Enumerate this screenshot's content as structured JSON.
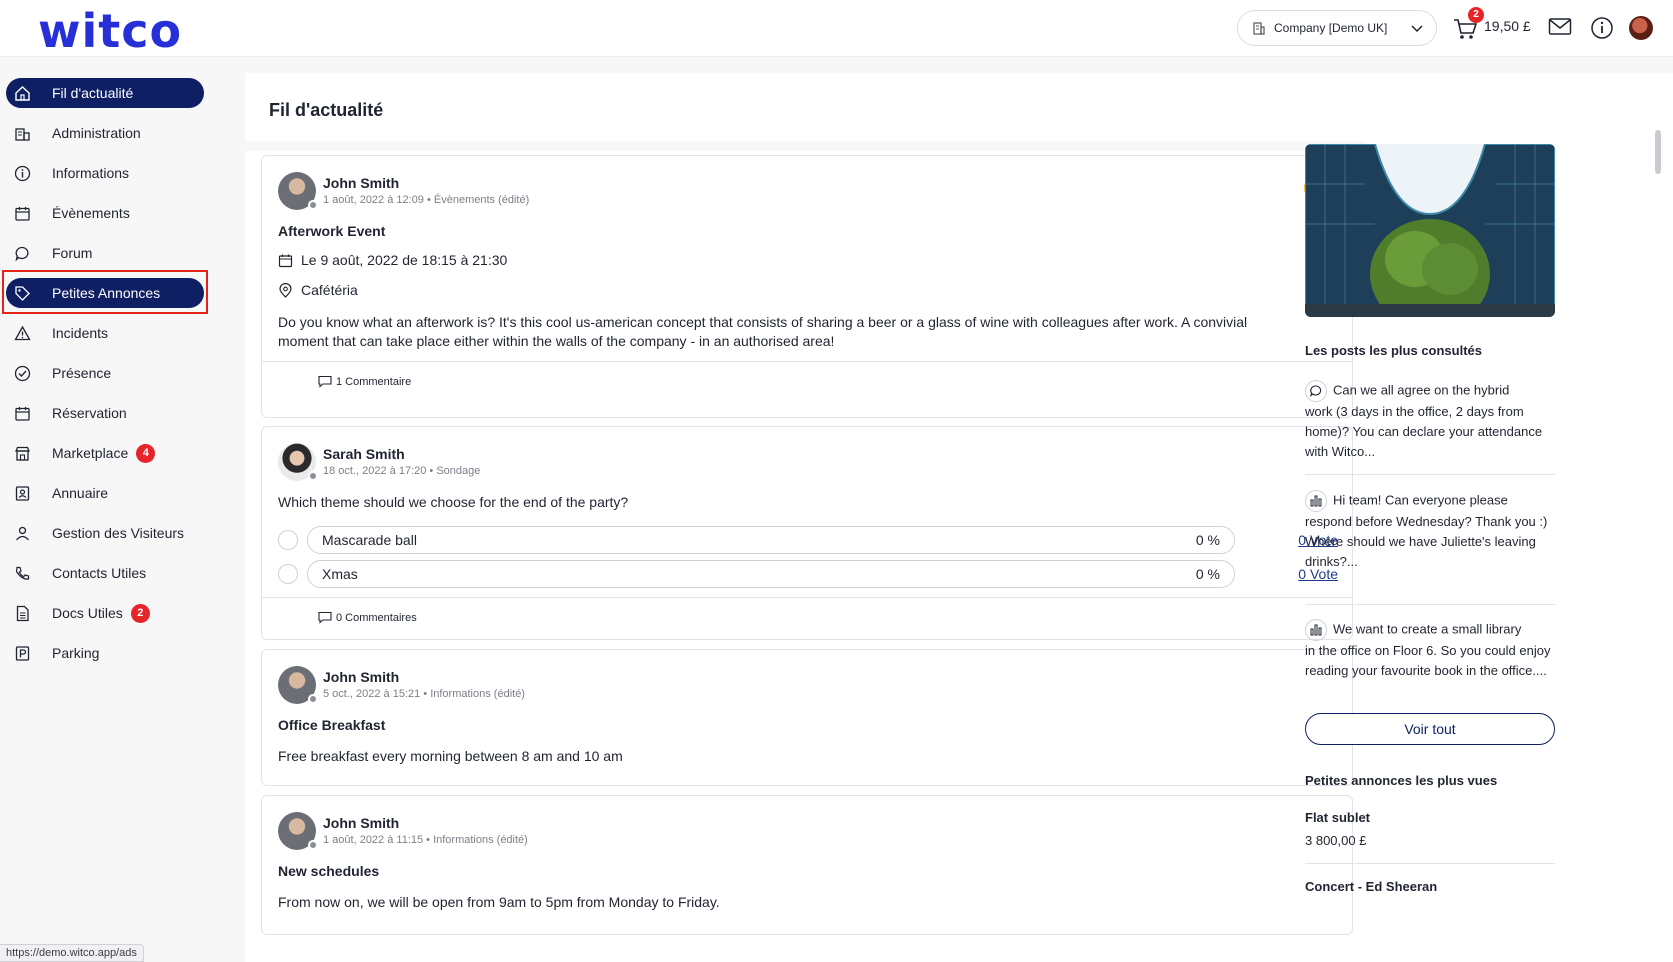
{
  "header": {
    "logo_text": "witco",
    "company_select": "Company [Demo UK]",
    "cart_badge": "2",
    "balance": "19,50 £"
  },
  "sidebar": {
    "items": [
      {
        "label": "Fil d'actualité",
        "icon": "home-icon"
      },
      {
        "label": "Administration",
        "icon": "building-icon"
      },
      {
        "label": "Informations",
        "icon": "info-icon"
      },
      {
        "label": "Évènements",
        "icon": "calendar-icon"
      },
      {
        "label": "Forum",
        "icon": "chat-icon"
      },
      {
        "label": "Petites Annonces",
        "icon": "tag-icon"
      },
      {
        "label": "Incidents",
        "icon": "warning-icon"
      },
      {
        "label": "Présence",
        "icon": "check-circle-icon"
      },
      {
        "label": "Réservation",
        "icon": "calendar-icon"
      },
      {
        "label": "Marketplace",
        "icon": "store-icon",
        "badge": "4"
      },
      {
        "label": "Annuaire",
        "icon": "contact-book-icon"
      },
      {
        "label": "Gestion des Visiteurs",
        "icon": "visitor-icon"
      },
      {
        "label": "Contacts Utiles",
        "icon": "phone-icon"
      },
      {
        "label": "Docs Utiles",
        "icon": "document-icon",
        "badge": "2"
      },
      {
        "label": "Parking",
        "icon": "parking-icon"
      }
    ]
  },
  "main": {
    "title": "Fil d'actualité",
    "posts": [
      {
        "author": "John Smith",
        "meta": "1 août, 2022 à 12:09 • Évènements (édité)",
        "title": "Afterwork Event",
        "date_line": "Le 9 août, 2022 de 18:15 à 21:30",
        "location": "Cafétéria",
        "body": "Do you know what an afterwork is? It's this cool us-american concept that consists of sharing a beer or a glass of wine with colleagues after work. A convivial moment that can take place either within the walls of the company - in an authorised area!",
        "comments": "1 Commentaire"
      },
      {
        "author": "Sarah Smith",
        "meta": "18 oct., 2022 à 17:20 • Sondage",
        "question": "Which theme should we choose for the end of the party?",
        "options": [
          {
            "label": "Mascarade ball",
            "percent": "0 %",
            "votes": "0 Vote"
          },
          {
            "label": "Xmas",
            "percent": "0 %",
            "votes": "0 Vote"
          }
        ],
        "comments": "0 Commentaires"
      },
      {
        "author": "John Smith",
        "meta": "5 oct., 2022 à 15:21 • Informations (édité)",
        "title": "Office Breakfast",
        "body": "Free breakfast every morning between 8 am and 10 am"
      },
      {
        "author": "John Smith",
        "meta": "1 août, 2022 à 11:15 • Informations (édité)",
        "title": "New schedules",
        "body": "From now on, we will be open from 9am to 5pm from Monday to Friday."
      }
    ]
  },
  "right": {
    "most_viewed_title": "Les posts les plus consultés",
    "most_viewed": [
      {
        "icon": "chat-icon",
        "line1": "Can we all agree on the hybrid",
        "rest": "work (3 days in the office, 2 days from home)? You can declare your attendance with Witco..."
      },
      {
        "icon": "poll-icon",
        "line1": "Hi team! Can everyone please",
        "rest": "respond before Wednesday? Thank you :)",
        "rest2": "Where should we have Juliette's leaving drinks?..."
      },
      {
        "icon": "poll-icon",
        "line1": "We want to create a small library",
        "rest": "in the office on Floor 6. So you could enjoy reading your favourite book in the office...."
      }
    ],
    "see_all": "Voir tout",
    "ads_title": "Petites annonces les plus vues",
    "ads": [
      {
        "title": "Flat sublet",
        "price": "3 800,00 £"
      },
      {
        "title": "Concert - Ed Sheeran"
      }
    ]
  },
  "status_url": "https://demo.witco.app/ads"
}
